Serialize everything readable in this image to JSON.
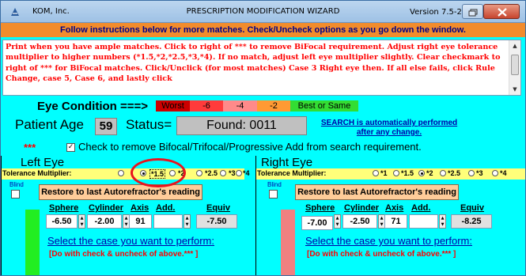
{
  "titlebar": {
    "company": "KOM, Inc.",
    "title": "PRESCRIPTION MODIFICATION WIZARD",
    "version": "Version 7.5-2"
  },
  "banner": "Follow instructions below for more matches. Check/Uncheck options as you go down the window.",
  "notes": "Print when you have ample matches. Click to right of *** to remove BiFocal requirement. Adjust right eye tolerance multiplier to higher numbers (*1.5,*2,*2.5,*3,*4). If no match, adjust left eye multiplier slightly. Clear checkmark to right of *** for BiFocal matches. Click/Unclick (for most matches) Case 3 Right eye then. If all else fails, click Rule Change, case 5, Case 6, and lastly click",
  "eye_condition": {
    "label": "Eye Condition ===>",
    "levels": [
      {
        "label": "Worst",
        "color": "#cc0000"
      },
      {
        "label": "-6",
        "color": "#ff3b3b"
      },
      {
        "label": "-4",
        "color": "#ff8a8a"
      },
      {
        "label": "-2",
        "color": "#ff9a33"
      },
      {
        "label": "Best or Same",
        "color": "#33dd33"
      }
    ]
  },
  "patient": {
    "age_label": "Patient Age",
    "age": "59",
    "status_label": "Status=",
    "status_value": "Found:  0011"
  },
  "search_note": "SEARCH is automatically performed after any change.",
  "bifocal": {
    "stars": "***",
    "checked": true,
    "label": "Check to remove Bifocal/Trifocal/Progressive Add from search requirement."
  },
  "left": {
    "title": "Left Eye",
    "tolerance_label": "Tolerance Multiplier:",
    "options": [
      "",
      "*1.5",
      "*2",
      "*2.5",
      "*3",
      "*4"
    ],
    "selected": "*1.5",
    "blind_label": "Blind",
    "restore_label": "Restore to last Autorefractor's reading",
    "headers": {
      "sphere": "Sphere",
      "cylinder": "Cylinder",
      "axis": "Axis",
      "add": "Add.",
      "equiv": "Equiv"
    },
    "values": {
      "sphere": "-6.50",
      "cylinder": "-2.00",
      "axis": "91",
      "add": "",
      "equiv": "-7.50"
    },
    "bar_color": "#22ee22",
    "select_case": "Select the case you want to perform:",
    "hint": "[Do with check & uncheck of above.*** ]"
  },
  "right": {
    "title": "Right Eye",
    "tolerance_label": "Tolerance Multiplier:",
    "options": [
      "*1",
      "*1.5",
      "*2",
      "*2.5",
      "*3",
      "*4"
    ],
    "selected": "*2",
    "blind_label": "Blind",
    "restore_label": "Restore to last Autorefractor's reading",
    "headers": {
      "sphere": "Sphere",
      "cylinder": "Cylinder",
      "axis": "Axis",
      "add": "Add.",
      "equiv": "Equiv"
    },
    "values": {
      "sphere": "-7.00",
      "cylinder": "-2.50",
      "axis": "71",
      "add": "",
      "equiv": "-8.25"
    },
    "bar_color": "#f08080",
    "select_case": "Select the case you want to perform:",
    "hint": "[Do with check & uncheck of above.*** ]"
  }
}
